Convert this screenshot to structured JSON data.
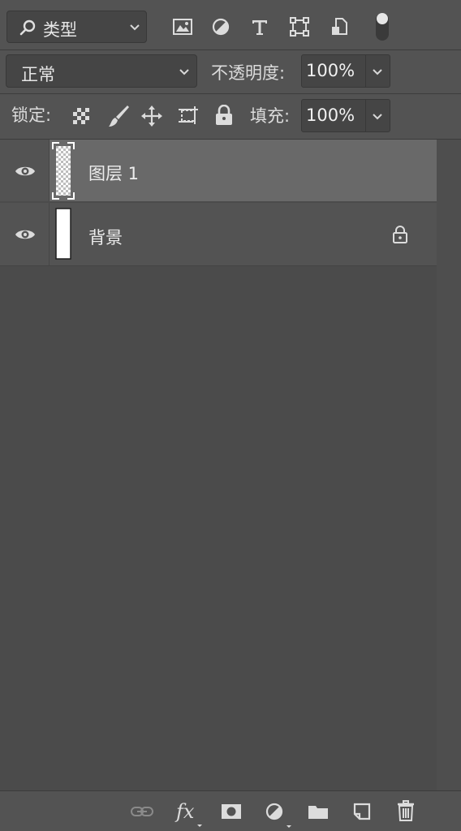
{
  "filter": {
    "kind_label": "类型",
    "icons": [
      "image-filter-icon",
      "adjustment-filter-icon",
      "text-filter-icon",
      "shape-filter-icon",
      "smart-object-filter-icon",
      "filter-toggle-icon"
    ]
  },
  "blend": {
    "mode": "正常",
    "opacity_label": "不透明度:",
    "opacity_value": "100%"
  },
  "lock": {
    "label": "锁定:",
    "fill_label": "填充:",
    "fill_value": "100%"
  },
  "layers": [
    {
      "name": "图层 1",
      "visible": true,
      "selected": true,
      "locked": false,
      "thumbnail": "transparent"
    },
    {
      "name": "背景",
      "visible": true,
      "selected": false,
      "locked": true,
      "thumbnail": "white"
    }
  ],
  "bottom_icons": [
    "link-layers-icon",
    "fx-icon",
    "mask-icon",
    "adjustment-layer-icon",
    "group-folder-icon",
    "new-layer-icon",
    "trash-icon"
  ],
  "colors": {
    "panel_bg": "#535353",
    "selected_row": "#696969",
    "field_bg": "#454545"
  }
}
